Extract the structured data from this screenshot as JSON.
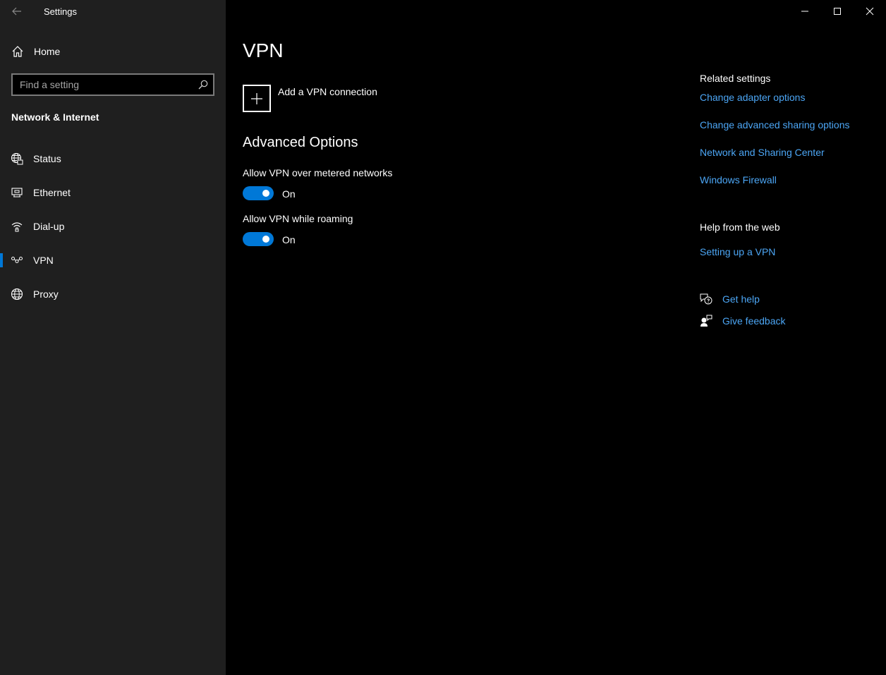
{
  "window": {
    "title": "Settings"
  },
  "sidebar": {
    "home_label": "Home",
    "search_placeholder": "Find a setting",
    "section_title": "Network & Internet",
    "items": [
      {
        "label": "Status",
        "icon": "globe-status-icon"
      },
      {
        "label": "Ethernet",
        "icon": "ethernet-icon"
      },
      {
        "label": "Dial-up",
        "icon": "dialup-icon"
      },
      {
        "label": "VPN",
        "icon": "vpn-icon",
        "selected": true
      },
      {
        "label": "Proxy",
        "icon": "globe-icon"
      }
    ]
  },
  "main": {
    "title": "VPN",
    "add_vpn_label": "Add a VPN connection",
    "advanced_title": "Advanced Options",
    "options": [
      {
        "label": "Allow VPN over metered networks",
        "state": "On",
        "on": true
      },
      {
        "label": "Allow VPN while roaming",
        "state": "On",
        "on": true
      }
    ]
  },
  "right_pane": {
    "related_heading": "Related settings",
    "related_links": [
      "Change adapter options",
      "Change advanced sharing options",
      "Network and Sharing Center",
      "Windows Firewall"
    ],
    "help_heading": "Help from the web",
    "help_links": [
      "Setting up a VPN"
    ],
    "get_help_label": "Get help",
    "give_feedback_label": "Give feedback"
  },
  "colors": {
    "accent": "#0078d7",
    "link": "#4ca6f5",
    "sidebar_bg": "#1f1f1f",
    "content_bg": "#000000"
  }
}
